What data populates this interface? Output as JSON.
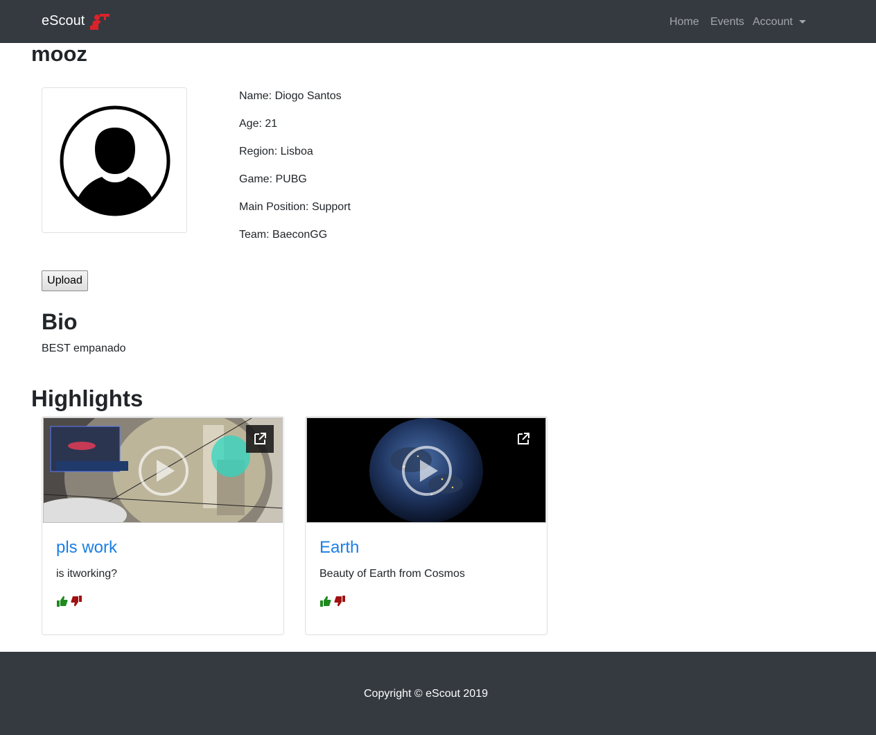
{
  "navbar": {
    "brand": "eScout",
    "links": [
      "Home",
      "Events",
      "Account"
    ]
  },
  "profile": {
    "username": "mooz",
    "info": [
      "Name: Diogo Santos",
      "Age: 21",
      "Region: Lisboa",
      "Game: PUBG",
      "Main Position: Support",
      "Team: BaeconGG"
    ],
    "upload_label": "Upload"
  },
  "bio": {
    "title": "Bio",
    "text": "BEST empanado"
  },
  "highlights": {
    "title": "Highlights",
    "cards": [
      {
        "title": "pls work",
        "description": "is itworking?"
      },
      {
        "title": "Earth",
        "description": "Beauty of Earth from Cosmos"
      }
    ]
  },
  "footer": {
    "copyright": "Copyright © eScout 2019"
  },
  "colors": {
    "navbar": "#343a40",
    "link": "#1a7ee6",
    "thumbs_up": "#1e8a1e",
    "thumbs_down": "#a11010",
    "logo": "#d9232a"
  },
  "icons": {
    "logo": "scout-logo-icon",
    "external": "external-link-icon",
    "play": "play-icon",
    "like": "thumbs-up-icon",
    "dislike": "thumbs-down-icon",
    "avatar": "user-avatar-icon"
  }
}
